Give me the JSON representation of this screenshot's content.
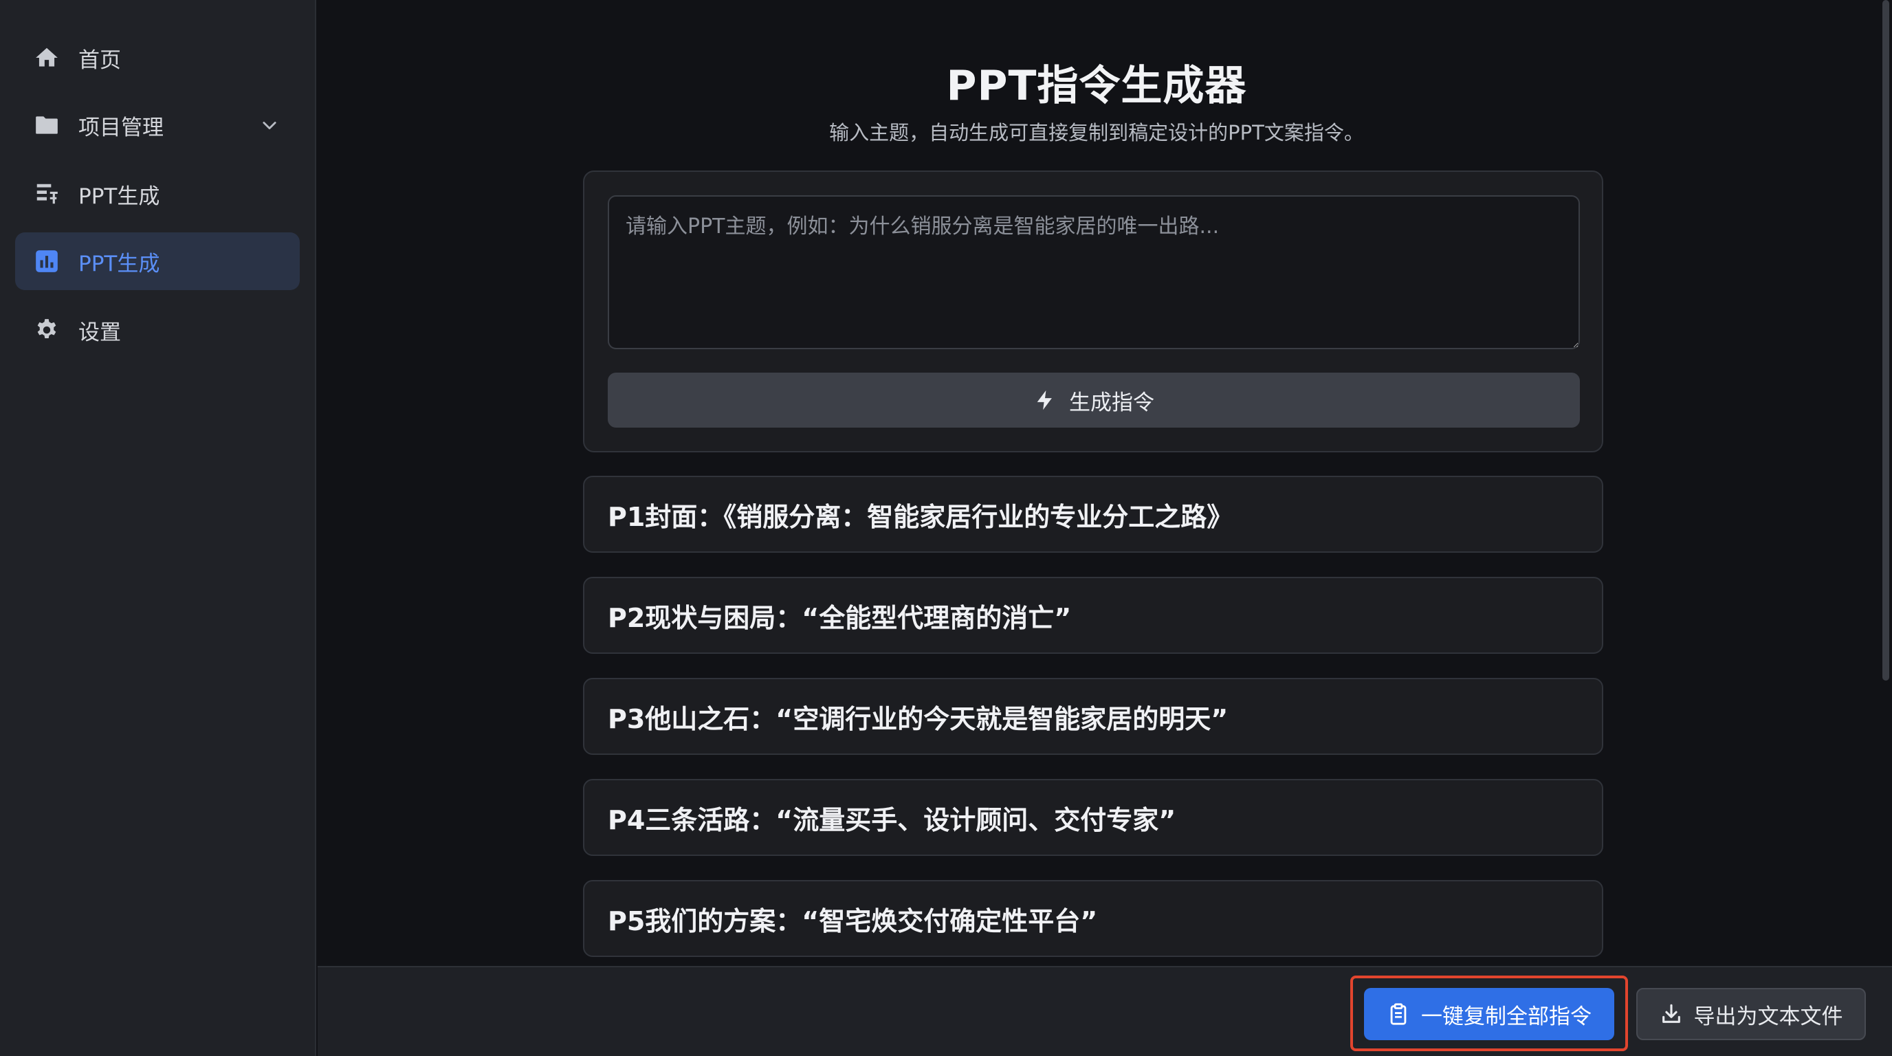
{
  "sidebar": {
    "items": [
      {
        "label": "首页",
        "icon": "home-icon"
      },
      {
        "label": "项目管理",
        "icon": "folder-icon",
        "expandable": true
      },
      {
        "label": "PPT生成",
        "icon": "form-icon"
      },
      {
        "label": "PPT生成",
        "icon": "bar-chart-icon",
        "active": true
      },
      {
        "label": "设置",
        "icon": "gear-icon"
      }
    ]
  },
  "main": {
    "title": "PPT指令生成器",
    "subtitle": "输入主题，自动生成可直接复制到稿定设计的PPT文案指令。",
    "topic_input": {
      "value": "",
      "placeholder": "请输入PPT主题，例如：为什么销服分离是智能家居的唯一出路..."
    },
    "generate_label": "生成指令",
    "slides": [
      "P1封面：《销服分离：智能家居行业的专业分工之路》",
      "P2现状与困局：“全能型代理商的消亡”",
      "P3他山之石：“空调行业的今天就是智能家居的明天”",
      "P4三条活路：“流量买手、设计顾问、交付专家”",
      "P5我们的方案：“智宅焕交付确定性平台”"
    ]
  },
  "footer": {
    "copy_all_label": "一键复制全部指令",
    "export_label": "导出为文本文件"
  },
  "colors": {
    "accent": "#2f6fe6",
    "active_text": "#5b8ff7",
    "highlight": "#e2452e"
  }
}
